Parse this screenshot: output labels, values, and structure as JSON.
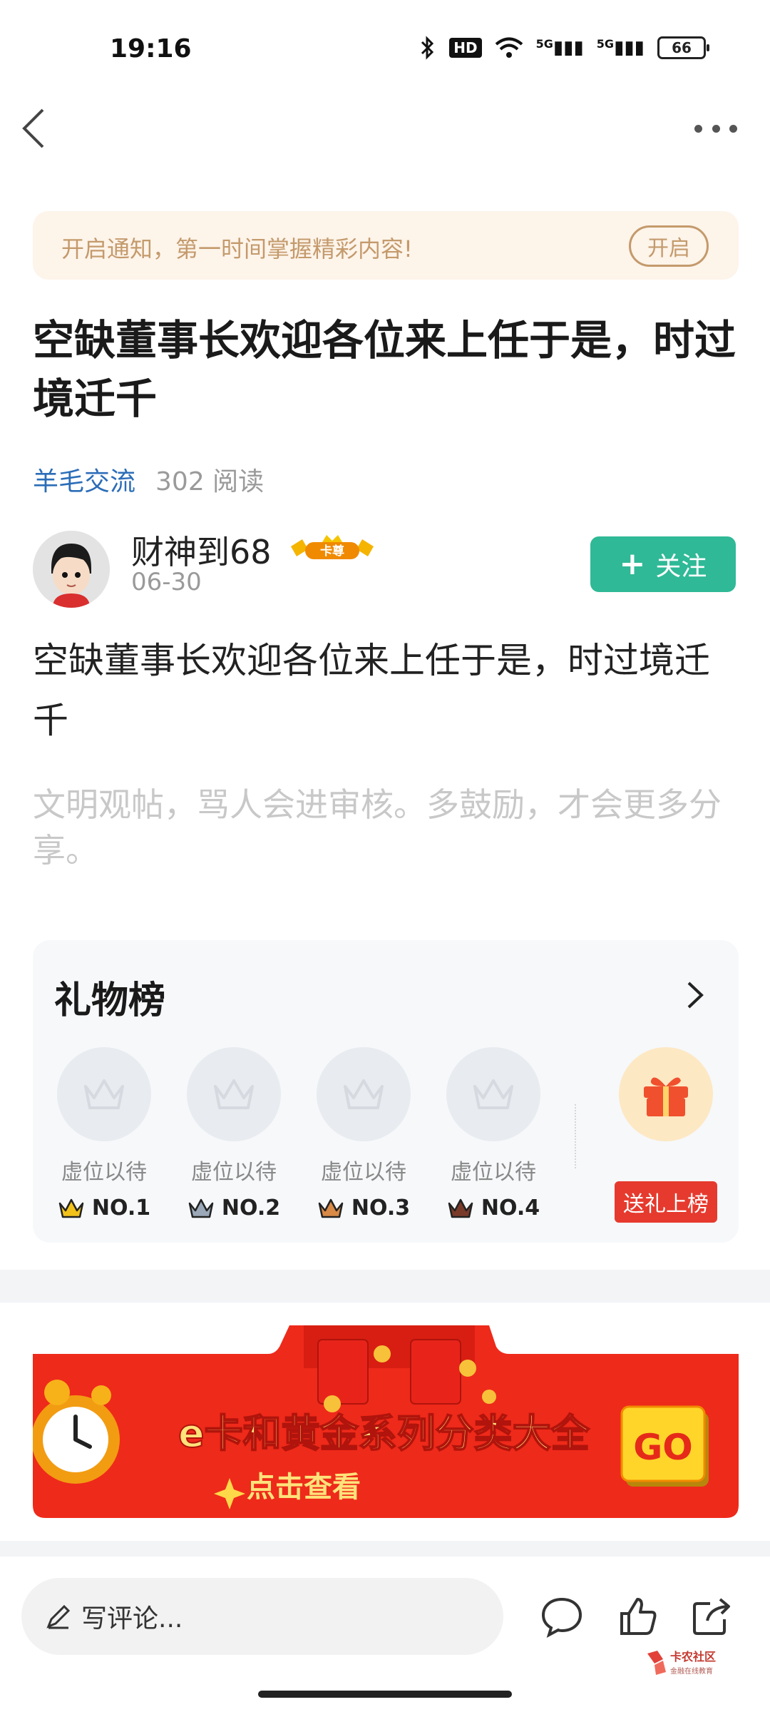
{
  "status_bar": {
    "time": "19:16",
    "hd_label": "HD",
    "network_1": "5G",
    "network_2": "5G",
    "battery": "66"
  },
  "notice": {
    "text": "开启通知，第一时间掌握精彩内容!",
    "button": "开启"
  },
  "post": {
    "title": "空缺董事长欢迎各位来上任于是，时过境迁千",
    "board": "羊毛交流",
    "reads": "302 阅读",
    "body": "空缺董事长欢迎各位来上任于是，时过境迁千",
    "hint": "文明观帖，骂人会进审核。多鼓励，才会更多分享。"
  },
  "author": {
    "name": "财神到68",
    "badge": "卡尊",
    "date": "06-30",
    "follow_label": "关注"
  },
  "gift_board": {
    "title": "礼物榜",
    "slots": [
      {
        "wait": "虚位以待",
        "rank": "NO.1",
        "color": "#f2c21a"
      },
      {
        "wait": "虚位以待",
        "rank": "NO.2",
        "color": "#9aa8b8"
      },
      {
        "wait": "虚位以待",
        "rank": "NO.3",
        "color": "#d88a46"
      },
      {
        "wait": "虚位以待",
        "rank": "NO.4",
        "color": "#7a3a2a"
      }
    ],
    "send_label": "送礼上榜"
  },
  "ad_banner": {
    "headline": "e卡和黄金系列分类大全",
    "sub": "点击查看",
    "go": "GO"
  },
  "bottom_bar": {
    "comment_placeholder": "写评论..."
  },
  "watermark": {
    "name": "卡农社区",
    "tagline": "金融在线教育"
  },
  "colors": {
    "accent_green": "#2fb996",
    "link_blue": "#2c6db8",
    "notice_gold": "#c49a6c",
    "gift_red": "#e63a2e"
  }
}
